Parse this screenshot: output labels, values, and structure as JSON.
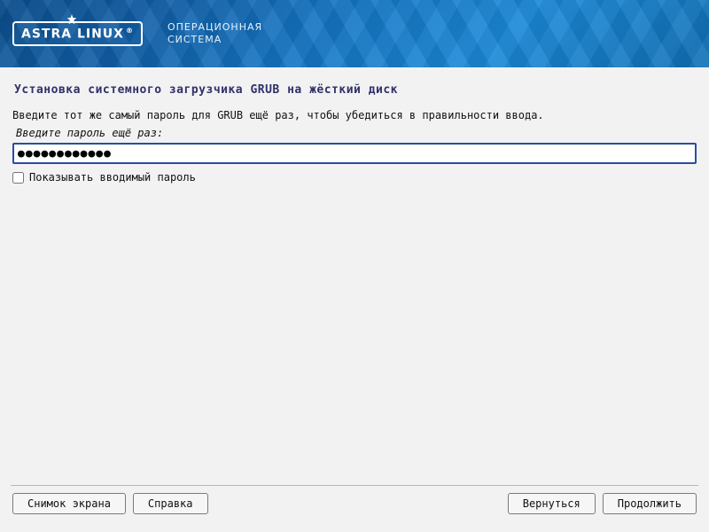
{
  "header": {
    "logo_text": "ASTRA LINUX",
    "logo_reg": "®",
    "subtitle_line1": "ОПЕРАЦИОННАЯ",
    "subtitle_line2": "СИСТЕМА"
  },
  "main": {
    "title": "Установка системного загрузчика GRUB на жёсткий диск",
    "instruction": "Введите тот же самый пароль для GRUB ещё раз, чтобы убедиться в правильности ввода.",
    "prompt": "Введите пароль ещё раз:",
    "password_value": "●●●●●●●●●●●●",
    "show_password_label": "Показывать вводимый пароль",
    "show_password_checked": false
  },
  "footer": {
    "screenshot": "Снимок экрана",
    "help": "Справка",
    "back": "Вернуться",
    "continue": "Продолжить"
  }
}
